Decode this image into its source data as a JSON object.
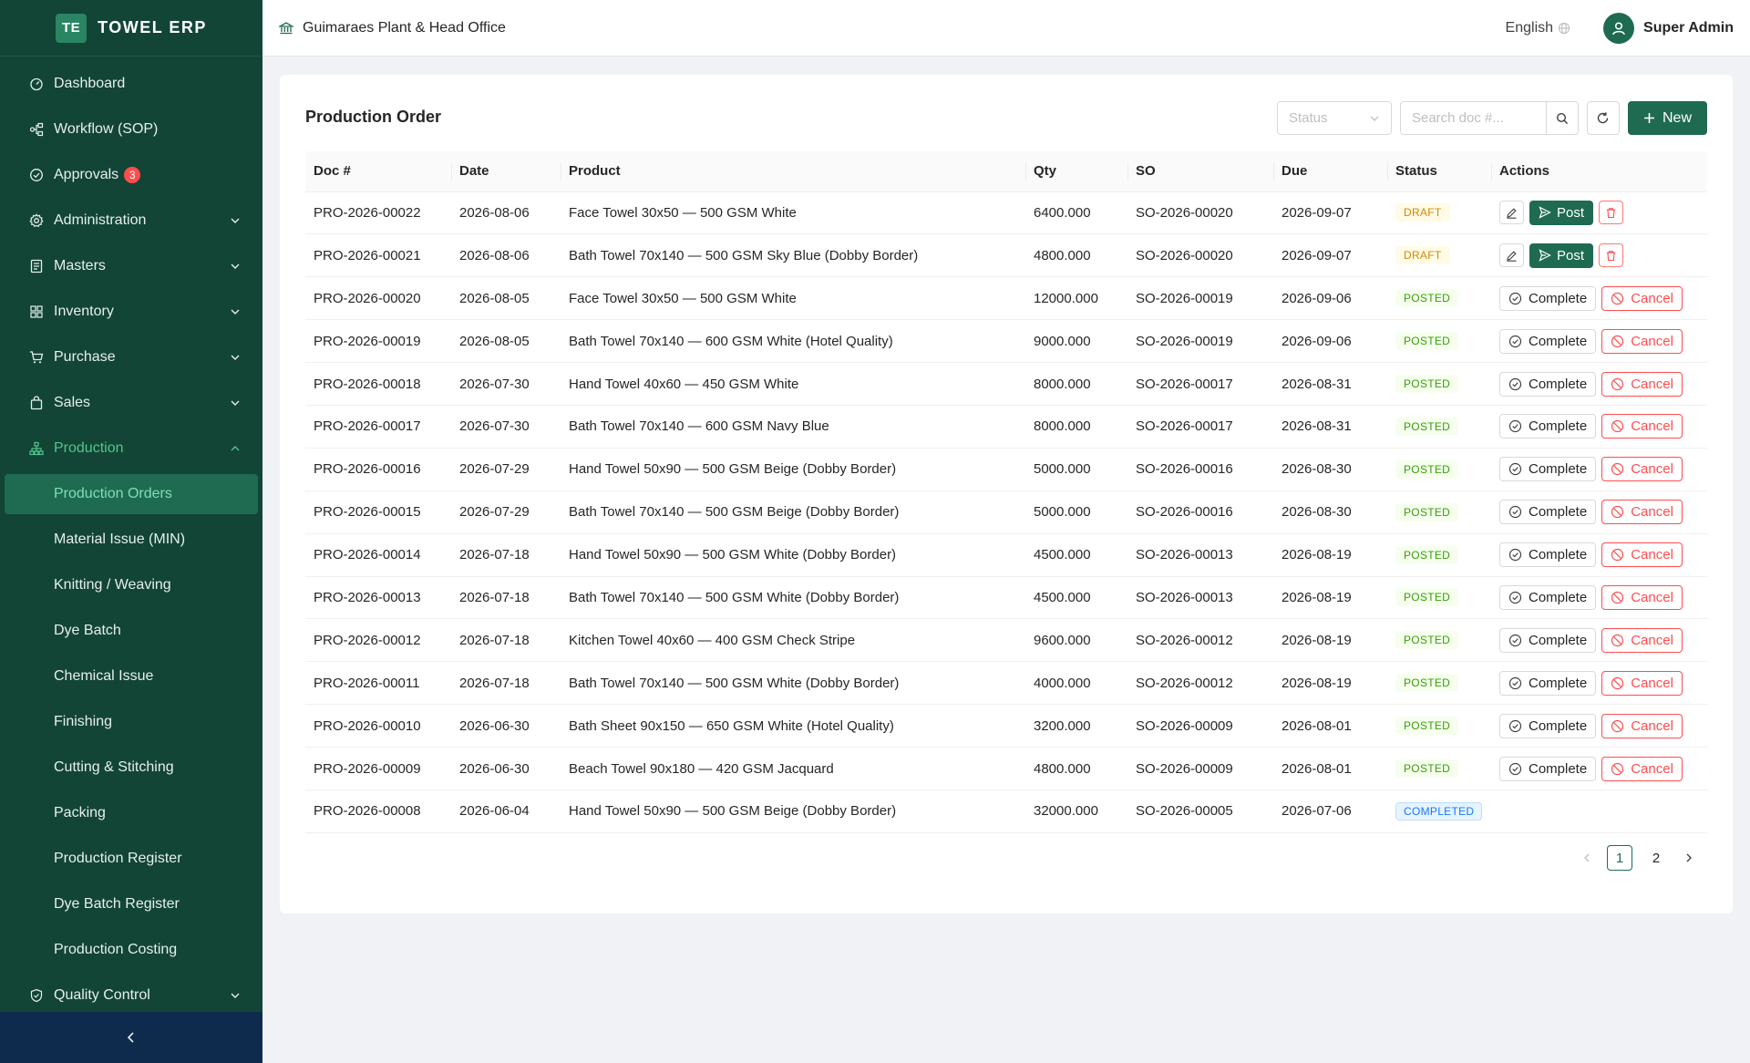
{
  "brand": {
    "logo": "TE",
    "name": "TOWEL ERP"
  },
  "sidebar": {
    "items": [
      {
        "label": "Dashboard",
        "icon": "dashboard-icon",
        "chevron": false
      },
      {
        "label": "Workflow (SOP)",
        "icon": "workflow-icon",
        "chevron": false
      },
      {
        "label": "Approvals",
        "icon": "check-circle-icon",
        "chevron": false,
        "badge": "3"
      },
      {
        "label": "Administration",
        "icon": "gear-icon",
        "chevron": true
      },
      {
        "label": "Masters",
        "icon": "book-icon",
        "chevron": true
      },
      {
        "label": "Inventory",
        "icon": "grid-icon",
        "chevron": true
      },
      {
        "label": "Purchase",
        "icon": "cart-icon",
        "chevron": true
      },
      {
        "label": "Sales",
        "icon": "bag-icon",
        "chevron": true
      },
      {
        "label": "Production",
        "icon": "hierarchy-icon",
        "chevron": true,
        "open": true
      }
    ],
    "production_sub": [
      {
        "label": "Production Orders",
        "active": true
      },
      {
        "label": "Material Issue (MIN)"
      },
      {
        "label": "Knitting / Weaving"
      },
      {
        "label": "Dye Batch"
      },
      {
        "label": "Chemical Issue"
      },
      {
        "label": "Finishing"
      },
      {
        "label": "Cutting & Stitching"
      },
      {
        "label": "Packing"
      },
      {
        "label": "Production Register"
      },
      {
        "label": "Dye Batch Register"
      },
      {
        "label": "Production Costing"
      }
    ],
    "after": [
      {
        "label": "Quality Control",
        "icon": "shield-check-icon",
        "chevron": true
      }
    ]
  },
  "header": {
    "org": "Guimaraes Plant & Head Office",
    "language": "English",
    "user": "Super Admin"
  },
  "page": {
    "title": "Production Order",
    "status_placeholder": "Status",
    "search_placeholder": "Search doc #...",
    "new_label": "New"
  },
  "table": {
    "columns": [
      "Doc #",
      "Date",
      "Product",
      "Qty",
      "SO",
      "Due",
      "Status",
      "Actions"
    ],
    "rows": [
      {
        "doc": "PRO-2026-00022",
        "date": "2026-08-06",
        "product": "Face Towel 30x50 — 500 GSM White",
        "qty": "6400.000",
        "so": "SO-2026-00020",
        "due": "2026-09-07",
        "status": "DRAFT"
      },
      {
        "doc": "PRO-2026-00021",
        "date": "2026-08-06",
        "product": "Bath Towel 70x140 — 500 GSM Sky Blue (Dobby Border)",
        "qty": "4800.000",
        "so": "SO-2026-00020",
        "due": "2026-09-07",
        "status": "DRAFT"
      },
      {
        "doc": "PRO-2026-00020",
        "date": "2026-08-05",
        "product": "Face Towel 30x50 — 500 GSM White",
        "qty": "12000.000",
        "so": "SO-2026-00019",
        "due": "2026-09-06",
        "status": "POSTED"
      },
      {
        "doc": "PRO-2026-00019",
        "date": "2026-08-05",
        "product": "Bath Towel 70x140 — 600 GSM White (Hotel Quality)",
        "qty": "9000.000",
        "so": "SO-2026-00019",
        "due": "2026-09-06",
        "status": "POSTED"
      },
      {
        "doc": "PRO-2026-00018",
        "date": "2026-07-30",
        "product": "Hand Towel 40x60 — 450 GSM White",
        "qty": "8000.000",
        "so": "SO-2026-00017",
        "due": "2026-08-31",
        "status": "POSTED"
      },
      {
        "doc": "PRO-2026-00017",
        "date": "2026-07-30",
        "product": "Bath Towel 70x140 — 600 GSM Navy Blue",
        "qty": "8000.000",
        "so": "SO-2026-00017",
        "due": "2026-08-31",
        "status": "POSTED"
      },
      {
        "doc": "PRO-2026-00016",
        "date": "2026-07-29",
        "product": "Hand Towel 50x90 — 500 GSM Beige (Dobby Border)",
        "qty": "5000.000",
        "so": "SO-2026-00016",
        "due": "2026-08-30",
        "status": "POSTED"
      },
      {
        "doc": "PRO-2026-00015",
        "date": "2026-07-29",
        "product": "Bath Towel 70x140 — 500 GSM Beige (Dobby Border)",
        "qty": "5000.000",
        "so": "SO-2026-00016",
        "due": "2026-08-30",
        "status": "POSTED"
      },
      {
        "doc": "PRO-2026-00014",
        "date": "2026-07-18",
        "product": "Hand Towel 50x90 — 500 GSM White (Dobby Border)",
        "qty": "4500.000",
        "so": "SO-2026-00013",
        "due": "2026-08-19",
        "status": "POSTED"
      },
      {
        "doc": "PRO-2026-00013",
        "date": "2026-07-18",
        "product": "Bath Towel 70x140 — 500 GSM White (Dobby Border)",
        "qty": "4500.000",
        "so": "SO-2026-00013",
        "due": "2026-08-19",
        "status": "POSTED"
      },
      {
        "doc": "PRO-2026-00012",
        "date": "2026-07-18",
        "product": "Kitchen Towel 40x60 — 400 GSM Check Stripe",
        "qty": "9600.000",
        "so": "SO-2026-00012",
        "due": "2026-08-19",
        "status": "POSTED"
      },
      {
        "doc": "PRO-2026-00011",
        "date": "2026-07-18",
        "product": "Bath Towel 70x140 — 500 GSM White (Dobby Border)",
        "qty": "4000.000",
        "so": "SO-2026-00012",
        "due": "2026-08-19",
        "status": "POSTED"
      },
      {
        "doc": "PRO-2026-00010",
        "date": "2026-06-30",
        "product": "Bath Sheet 90x150 — 650 GSM White (Hotel Quality)",
        "qty": "3200.000",
        "so": "SO-2026-00009",
        "due": "2026-08-01",
        "status": "POSTED"
      },
      {
        "doc": "PRO-2026-00009",
        "date": "2026-06-30",
        "product": "Beach Towel 90x180 — 420 GSM Jacquard",
        "qty": "4800.000",
        "so": "SO-2026-00009",
        "due": "2026-08-01",
        "status": "POSTED"
      },
      {
        "doc": "PRO-2026-00008",
        "date": "2026-06-04",
        "product": "Hand Towel 50x90 — 500 GSM Beige (Dobby Border)",
        "qty": "32000.000",
        "so": "SO-2026-00005",
        "due": "2026-07-06",
        "status": "COMPLETED"
      }
    ],
    "action_labels": {
      "post": "Post",
      "complete": "Complete",
      "cancel": "Cancel"
    }
  },
  "pagination": {
    "pages": [
      "1",
      "2"
    ],
    "current": "1"
  },
  "colors": {
    "sidebar": "#124536",
    "accent": "#1f6b52",
    "danger": "#ff4d4f"
  }
}
